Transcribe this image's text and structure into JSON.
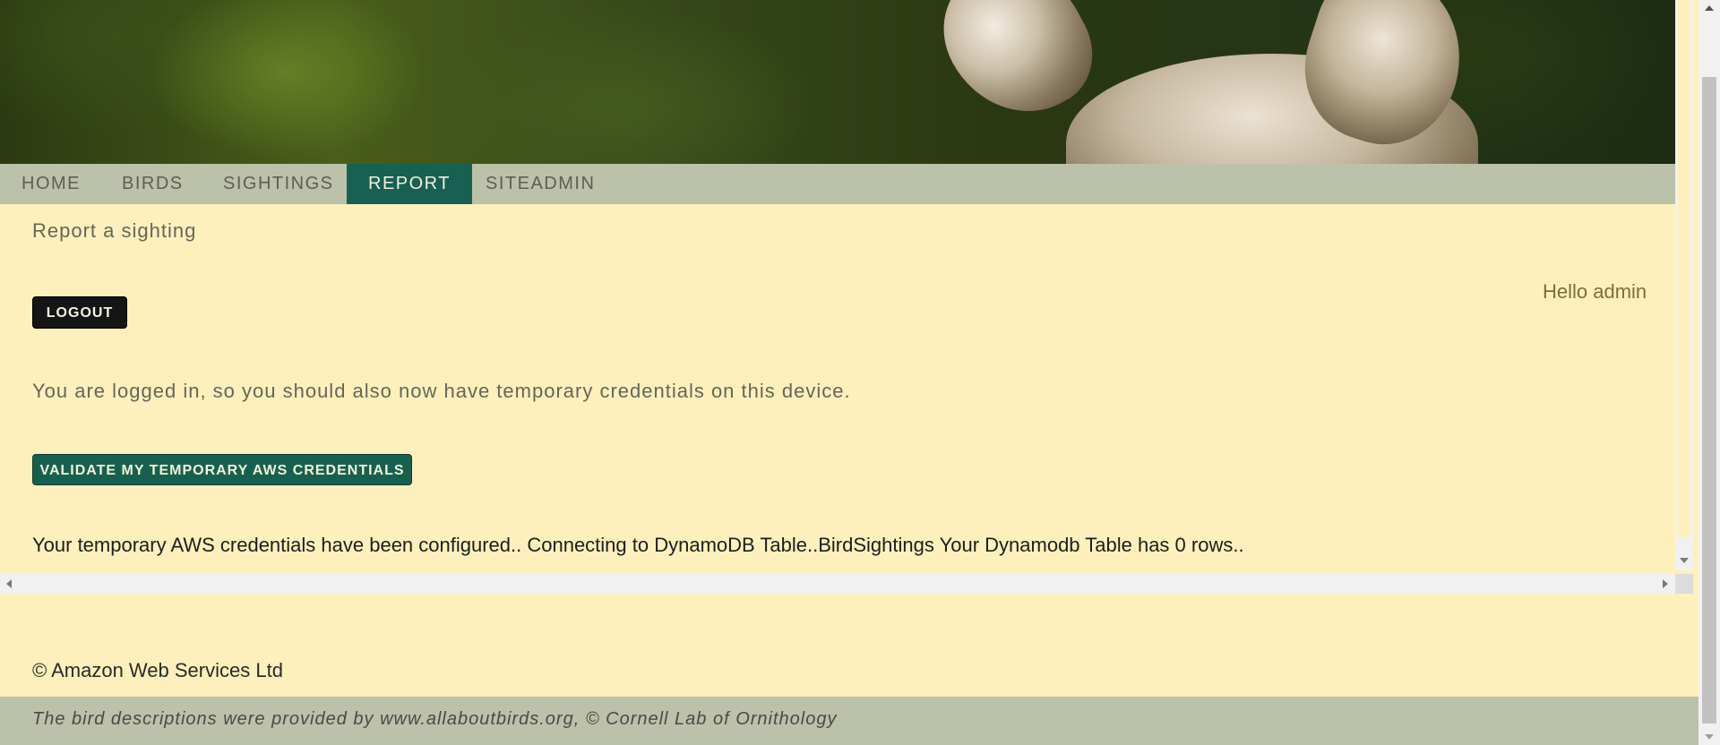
{
  "nav": {
    "items": [
      {
        "label": "HOME"
      },
      {
        "label": "BIRDS"
      },
      {
        "label": "SIGHTINGS"
      },
      {
        "label": "REPORT",
        "active": true
      },
      {
        "label": "SITEADMIN"
      }
    ]
  },
  "main": {
    "title": "Report a sighting",
    "greeting": "Hello admin",
    "logout_label": "LOGOUT",
    "info_text": "You are logged in, so you should also now have temporary credentials on this device.",
    "validate_label": "VALIDATE MY TEMPORARY AWS CREDENTIALS",
    "result_text": "Your temporary AWS credentials have been configured.. Connecting to DynamoDB Table..BirdSightings Your Dynamodb Table has 0 rows.."
  },
  "footer": {
    "copyright": "© Amazon Web Services Ltd",
    "attribution": "The bird descriptions were provided by www.allaboutbirds.org, © Cornell Lab of Ornithology"
  },
  "colors": {
    "page_background": "#fdf0bc",
    "nav_background": "#bcc1aa",
    "nav_active": "#186052",
    "logout_button": "#151515",
    "validate_button": "#17604f",
    "greeting_text": "#7a7136"
  }
}
